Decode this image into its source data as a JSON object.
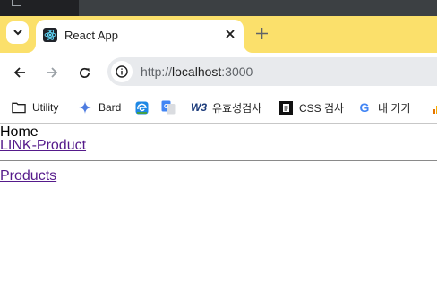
{
  "browser": {
    "tab": {
      "title": "React App",
      "close_icon": "close-icon",
      "favicon": "react-logo-icon"
    },
    "new_tab_icon": "plus-icon",
    "omnibox": {
      "scheme": "http://",
      "host": "localhost",
      "port": ":3000",
      "site_info_icon": "info-icon"
    },
    "nav": {
      "back_icon": "arrow-left-icon",
      "forward_icon": "arrow-right-icon",
      "reload_icon": "reload-icon"
    },
    "bookmarks": [
      {
        "label": "Utility",
        "icon": "folder-icon"
      },
      {
        "label": "Bard",
        "icon": "bard-sparkle-icon"
      },
      {
        "label": "",
        "icon": "edge-like-icon"
      },
      {
        "label": "",
        "icon": "google-translate-icon"
      },
      {
        "label": "유효성검사",
        "icon": "w3c-icon",
        "icon_text": "W3"
      },
      {
        "label": "CSS 검사",
        "icon": "css-validator-icon"
      },
      {
        "label": "내 기기",
        "icon": "google-g-icon",
        "icon_text": "G"
      }
    ]
  },
  "page": {
    "home_text": "Home",
    "link_product": "LINK-Product",
    "link_products": "Products"
  }
}
